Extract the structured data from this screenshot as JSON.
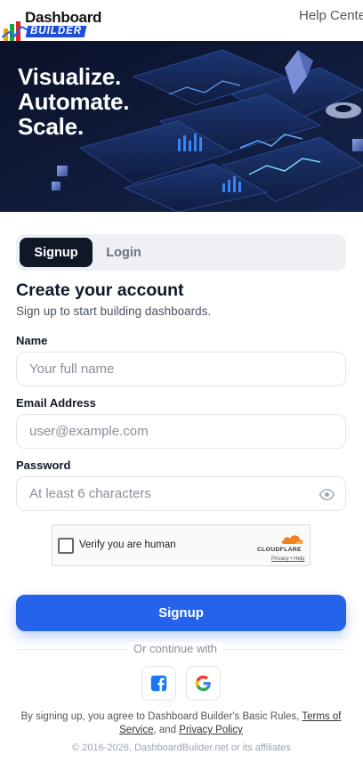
{
  "header": {
    "logo_top": "Dashboard",
    "logo_bottom": "BUILDER",
    "logo_mark": "®",
    "help_link": "Help Center"
  },
  "hero": {
    "lines": [
      "Visualize.",
      "Automate.",
      "Scale."
    ]
  },
  "tabs": [
    {
      "label": "Signup",
      "active": true
    },
    {
      "label": "Login",
      "active": false
    }
  ],
  "form": {
    "title": "Create your account",
    "subtitle": "Sign up to start building dashboards.",
    "name": {
      "label": "Name",
      "placeholder": "Your full name",
      "value": ""
    },
    "email": {
      "label": "Email Address",
      "placeholder": "user@example.com",
      "value": ""
    },
    "password": {
      "label": "Password",
      "placeholder": "At least 6 characters",
      "value": ""
    }
  },
  "captcha": {
    "text": "Verify you are human",
    "brand": "CLOUDFLARE",
    "privacy": "Privacy",
    "sep": " • ",
    "help": "Help"
  },
  "submit_label": "Signup",
  "continue_with": "Or continue with",
  "social": [
    {
      "icon": "facebook-icon"
    },
    {
      "icon": "google-icon"
    }
  ],
  "terms": {
    "prefix": "By signing up, you agree to Dashboard Builder's Basic Rules, ",
    "terms_link": "Terms of Service",
    "middle": ", and ",
    "privacy_link": "Privacy Policy"
  },
  "copyright": "© 2016-2026, DashboardBuilder.net or its affiliates",
  "colors": {
    "primary": "#2563eb",
    "tab_active": "#101827",
    "hero_bg": "#0b1430"
  }
}
